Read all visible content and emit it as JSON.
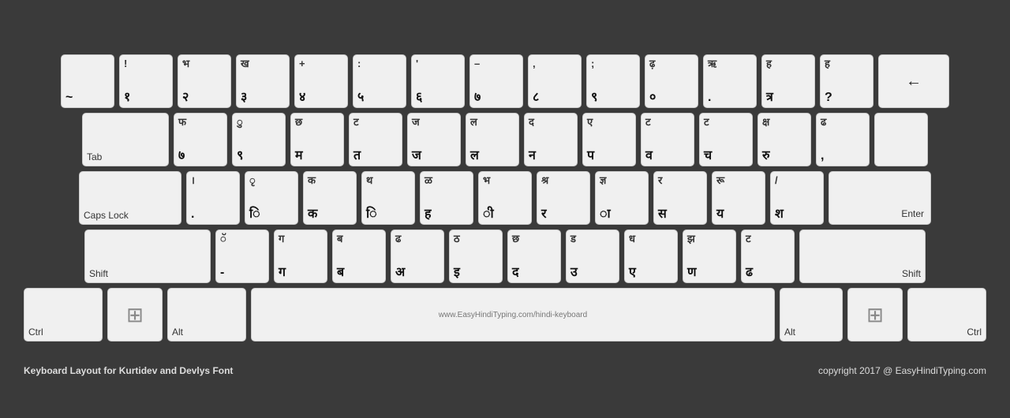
{
  "keyboard": {
    "title": "Keyboard Layout for Kurtidev and Devlys Font",
    "subtitle": "copyright 2017 @ EasyHindiTyping.com",
    "url": "www.EasyHindiTyping.com/hindi-keyboard",
    "rows": [
      {
        "keys": [
          {
            "id": "backtick",
            "top": "",
            "bottom": "~",
            "label": "",
            "class": ""
          },
          {
            "id": "1",
            "top": "!",
            "bottom": "१",
            "label": "",
            "class": ""
          },
          {
            "id": "2",
            "top": "भ",
            "bottom": "२",
            "label": "",
            "class": ""
          },
          {
            "id": "3",
            "top": "ख",
            "bottom": "३",
            "label": "",
            "class": ""
          },
          {
            "id": "4",
            "top": "+",
            "bottom": "४",
            "label": "",
            "class": ""
          },
          {
            "id": "5",
            "top": ":",
            "bottom": "५",
            "label": "",
            "class": ""
          },
          {
            "id": "6",
            "top": "'",
            "bottom": "६",
            "label": "",
            "class": ""
          },
          {
            "id": "7",
            "top": "–",
            "bottom": "७",
            "label": "",
            "class": ""
          },
          {
            "id": "8",
            "top": ",",
            "bottom": "८",
            "label": "",
            "class": ""
          },
          {
            "id": "9",
            "top": ";",
            "bottom": "९",
            "label": "",
            "class": ""
          },
          {
            "id": "0",
            "top": "ढ़",
            "bottom": "०",
            "label": "",
            "class": ""
          },
          {
            "id": "minus",
            "top": "ऋ",
            "bottom": ".",
            "label": "",
            "class": ""
          },
          {
            "id": "equals",
            "top": "ह",
            "bottom": "त्र",
            "label": "",
            "class": ""
          },
          {
            "id": "bracket",
            "top": "ह",
            "bottom": "?",
            "label": "",
            "class": ""
          },
          {
            "id": "backspace",
            "top": "",
            "bottom": "←",
            "label": "",
            "class": "key-backspace"
          }
        ]
      },
      {
        "keys": [
          {
            "id": "tab",
            "top": "",
            "bottom": "",
            "label": "Tab",
            "class": "key-tab"
          },
          {
            "id": "q",
            "top": "फ",
            "bottom": "७",
            "label": "",
            "class": ""
          },
          {
            "id": "w",
            "top": "ु",
            "bottom": "९",
            "label": "",
            "class": ""
          },
          {
            "id": "e",
            "top": "छ",
            "bottom": "म",
            "label": "",
            "class": ""
          },
          {
            "id": "r",
            "top": "ट",
            "bottom": "त",
            "label": "",
            "class": ""
          },
          {
            "id": "t",
            "top": "ज",
            "bottom": "ज",
            "label": "",
            "class": ""
          },
          {
            "id": "y",
            "top": "ल",
            "bottom": "ल",
            "label": "",
            "class": ""
          },
          {
            "id": "u",
            "top": "द",
            "bottom": "न",
            "label": "",
            "class": ""
          },
          {
            "id": "i",
            "top": "ए",
            "bottom": "प",
            "label": "",
            "class": ""
          },
          {
            "id": "o",
            "top": "ट",
            "bottom": "व",
            "label": "",
            "class": ""
          },
          {
            "id": "p",
            "top": "ट",
            "bottom": "च",
            "label": "",
            "class": ""
          },
          {
            "id": "lbracket",
            "top": "क्ष",
            "bottom": "रु",
            "label": "",
            "class": ""
          },
          {
            "id": "rbracket",
            "top": "ढ",
            "bottom": ",",
            "label": "",
            "class": ""
          },
          {
            "id": "backslash",
            "top": "",
            "bottom": "",
            "label": "",
            "class": "key-enter"
          }
        ]
      },
      {
        "keys": [
          {
            "id": "capslock",
            "top": "",
            "bottom": "",
            "label": "Caps Lock",
            "class": "key-capslock"
          },
          {
            "id": "a",
            "top": "।",
            "bottom": ".",
            "label": "",
            "class": ""
          },
          {
            "id": "s",
            "top": "ृ",
            "bottom": "ि",
            "label": "",
            "class": ""
          },
          {
            "id": "d",
            "top": "क",
            "bottom": "क",
            "label": "",
            "class": ""
          },
          {
            "id": "f",
            "top": "थ",
            "bottom": "ि",
            "label": "",
            "class": ""
          },
          {
            "id": "g",
            "top": "ळ",
            "bottom": "ह",
            "label": "",
            "class": ""
          },
          {
            "id": "h",
            "top": "भ",
            "bottom": "ी",
            "label": "",
            "class": ""
          },
          {
            "id": "j",
            "top": "श्र",
            "bottom": "र",
            "label": "",
            "class": ""
          },
          {
            "id": "k",
            "top": "ज्ञ",
            "bottom": "ा",
            "label": "",
            "class": ""
          },
          {
            "id": "l",
            "top": "र",
            "bottom": "स",
            "label": "",
            "class": ""
          },
          {
            "id": "semicolon",
            "top": "रू",
            "bottom": "य",
            "label": "",
            "class": ""
          },
          {
            "id": "quote",
            "top": "/",
            "bottom": "श",
            "label": "",
            "class": ""
          },
          {
            "id": "enter",
            "top": "",
            "bottom": "",
            "label": "Enter",
            "class": "key-enter"
          }
        ]
      },
      {
        "keys": [
          {
            "id": "shift-l",
            "top": "",
            "bottom": "",
            "label": "Shift",
            "class": "key-shift-l"
          },
          {
            "id": "z",
            "top": "ॅ",
            "bottom": "-",
            "label": "",
            "class": ""
          },
          {
            "id": "x",
            "top": "ग",
            "bottom": "ग",
            "label": "",
            "class": ""
          },
          {
            "id": "c",
            "top": "ब",
            "bottom": "ब",
            "label": "",
            "class": ""
          },
          {
            "id": "v",
            "top": "ढ",
            "bottom": "अ",
            "label": "",
            "class": ""
          },
          {
            "id": "b",
            "top": "ठ",
            "bottom": "इ",
            "label": "",
            "class": ""
          },
          {
            "id": "n",
            "top": "छ",
            "bottom": "द",
            "label": "",
            "class": ""
          },
          {
            "id": "m",
            "top": "ड",
            "bottom": "उ",
            "label": "",
            "class": ""
          },
          {
            "id": "comma",
            "top": "ध",
            "bottom": "ए",
            "label": "",
            "class": ""
          },
          {
            "id": "period",
            "top": "झ",
            "bottom": "ण",
            "label": "",
            "class": ""
          },
          {
            "id": "slash",
            "top": "ट",
            "bottom": "ढ",
            "label": "",
            "class": ""
          },
          {
            "id": "shift-r",
            "top": "",
            "bottom": "",
            "label": "Shift",
            "class": "key-shift-r"
          }
        ]
      },
      {
        "keys": [
          {
            "id": "ctrl-l",
            "top": "",
            "bottom": "",
            "label": "Ctrl",
            "class": "key-ctrl-l"
          },
          {
            "id": "win-l",
            "top": "",
            "bottom": "",
            "label": "win",
            "class": "key-win-l"
          },
          {
            "id": "alt-l",
            "top": "",
            "bottom": "",
            "label": "Alt",
            "class": "key-alt-l"
          },
          {
            "id": "space",
            "top": "",
            "bottom": "",
            "label": "",
            "class": "key-space"
          },
          {
            "id": "alt-r",
            "top": "",
            "bottom": "",
            "label": "Alt",
            "class": "key-alt-r"
          },
          {
            "id": "win-r",
            "top": "",
            "bottom": "",
            "label": "win",
            "class": "key-win-r"
          },
          {
            "id": "ctrl-r",
            "top": "",
            "bottom": "",
            "label": "Ctrl",
            "class": "key-ctrl-r"
          }
        ]
      }
    ]
  }
}
